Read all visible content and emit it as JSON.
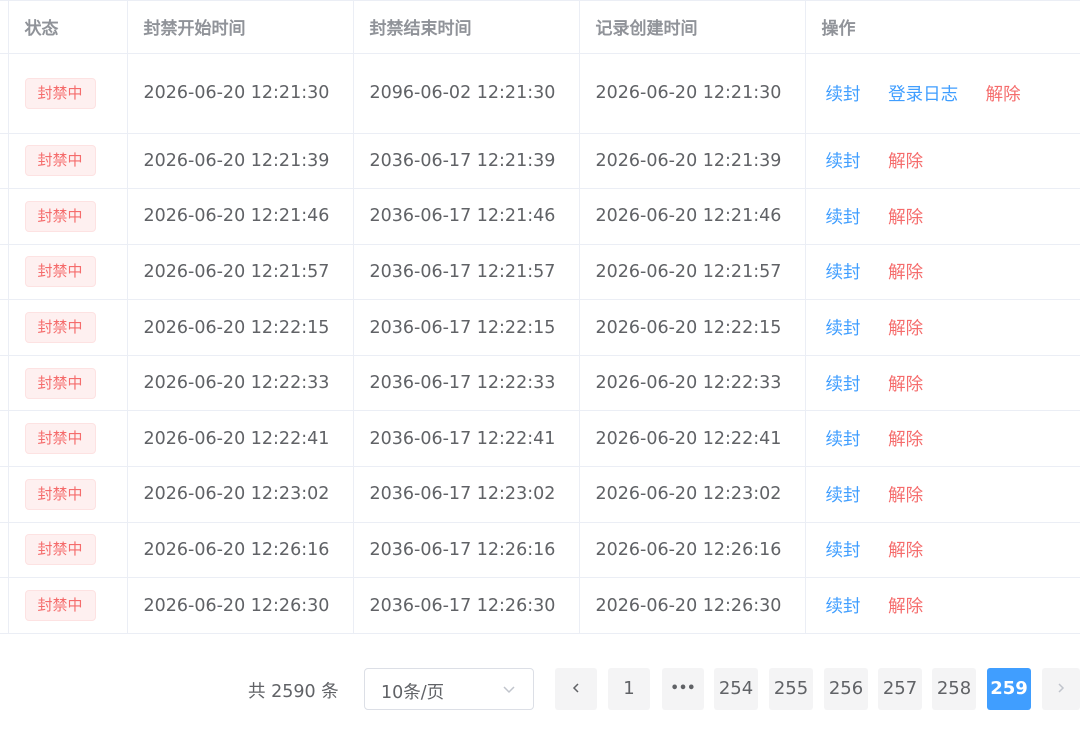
{
  "table": {
    "headers": {
      "status": "状态",
      "start": "封禁开始时间",
      "end": "封禁结束时间",
      "created": "记录创建时间",
      "ops": "操作"
    },
    "status_tag": "封禁中",
    "ops": {
      "renew": "续封",
      "login_log": "登录日志",
      "unban": "解除"
    },
    "rows": [
      {
        "start": "2026-06-20 12:21:30",
        "end": "2096-06-02 12:21:30",
        "created": "2026-06-20 12:21:30"
      },
      {
        "start": "2026-06-20 12:21:39",
        "end": "2036-06-17 12:21:39",
        "created": "2026-06-20 12:21:39"
      },
      {
        "start": "2026-06-20 12:21:46",
        "end": "2036-06-17 12:21:46",
        "created": "2026-06-20 12:21:46"
      },
      {
        "start": "2026-06-20 12:21:57",
        "end": "2036-06-17 12:21:57",
        "created": "2026-06-20 12:21:57"
      },
      {
        "start": "2026-06-20 12:22:15",
        "end": "2036-06-17 12:22:15",
        "created": "2026-06-20 12:22:15"
      },
      {
        "start": "2026-06-20 12:22:33",
        "end": "2036-06-17 12:22:33",
        "created": "2026-06-20 12:22:33"
      },
      {
        "start": "2026-06-20 12:22:41",
        "end": "2036-06-17 12:22:41",
        "created": "2026-06-20 12:22:41"
      },
      {
        "start": "2026-06-20 12:23:02",
        "end": "2036-06-17 12:23:02",
        "created": "2026-06-20 12:23:02"
      },
      {
        "start": "2026-06-20 12:26:16",
        "end": "2036-06-17 12:26:16",
        "created": "2026-06-20 12:26:16"
      },
      {
        "start": "2026-06-20 12:26:30",
        "end": "2036-06-17 12:26:30",
        "created": "2026-06-20 12:26:30"
      }
    ]
  },
  "pagination": {
    "total_text": "共 2590 条",
    "page_size": "10条/页",
    "prev_icon": "chevron-left-icon",
    "next_icon": "chevron-right-icon",
    "first_page": "1",
    "ellipsis": "•••",
    "pages": [
      "254",
      "255",
      "256",
      "257",
      "258",
      "259"
    ],
    "current_page": "259"
  },
  "colors": {
    "primary": "#409eff",
    "danger": "#f56c6c",
    "tag_bg": "#fef0f0",
    "tag_border": "#fde2e2"
  }
}
